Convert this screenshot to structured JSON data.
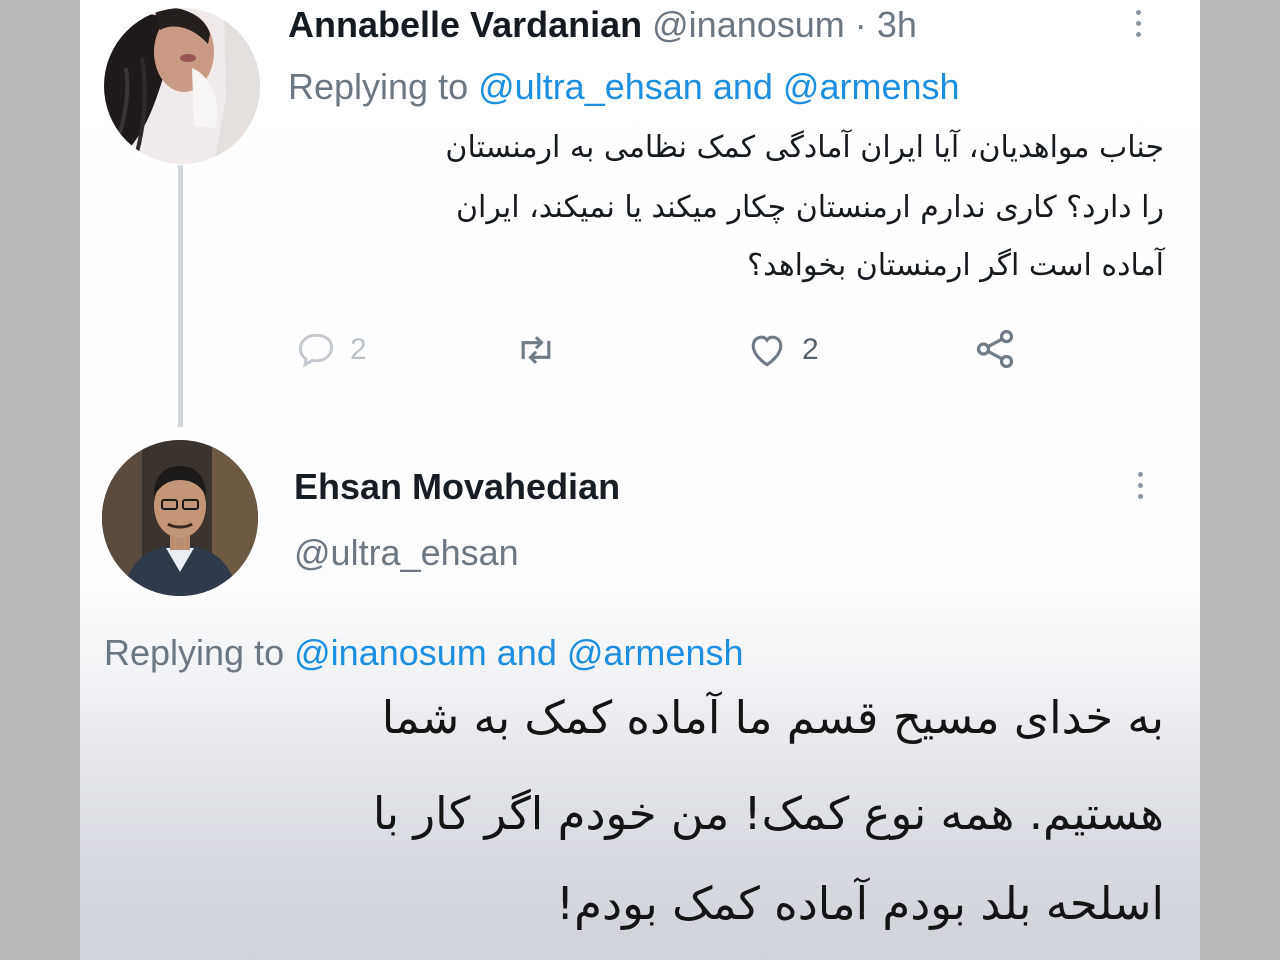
{
  "tweet1": {
    "author_name": "Annabelle Vardanian",
    "author_handle": "@inanosum",
    "separator": "·",
    "time": "3h",
    "replying_prefix": "Replying to",
    "mention1": "@ultra_ehsan",
    "joiner": "and",
    "mention2": "@armensh",
    "body_lines": [
      "جناب مواهدیان، آیا ایران آمادگی کمک نظامی به ارمنستان",
      "را دارد؟ کاری ندارم ارمنستان چکار میکند یا نمیکند، ایران",
      "آماده است اگر ارمنستان بخواهد؟"
    ],
    "actions": {
      "reply_count": "2",
      "like_count": "2"
    },
    "icons": [
      "reply-icon",
      "retweet-icon",
      "like-icon",
      "share-icon",
      "more-options-icon"
    ]
  },
  "tweet2": {
    "author_name": "Ehsan Movahedian",
    "author_handle": "@ultra_ehsan",
    "replying_prefix": "Replying to",
    "mention1": "@inanosum",
    "joiner": "and",
    "mention2": "@armensh",
    "body_lines": [
      "به خدای مسیح قسم ما آماده کمک به شما",
      "هستیم. همه نوع کمک! من خودم اگر کار با",
      "اسلحه بلد بودم آماده کمک بودم!"
    ]
  },
  "colors": {
    "accent": "#1d8fe0",
    "secondary_text": "#6b7783",
    "thread_line": "#cfd6dc"
  }
}
